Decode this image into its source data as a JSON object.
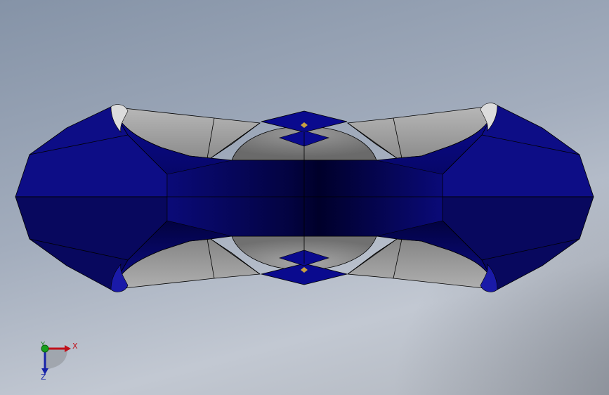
{
  "viewport": {
    "background_top": "#8593a7",
    "background_bottom": "#c2c8d2"
  },
  "model": {
    "face_color_primary": "#0a0a8a",
    "face_color_dark": "#00003a",
    "face_color_secondary": "#9a9a9a",
    "edge_color": "#000000"
  },
  "triad": {
    "x_label": "X",
    "y_label": "Y",
    "z_label": "Z",
    "x_color": "#c0101a",
    "y_color": "#17801b",
    "z_color": "#1622a8"
  }
}
